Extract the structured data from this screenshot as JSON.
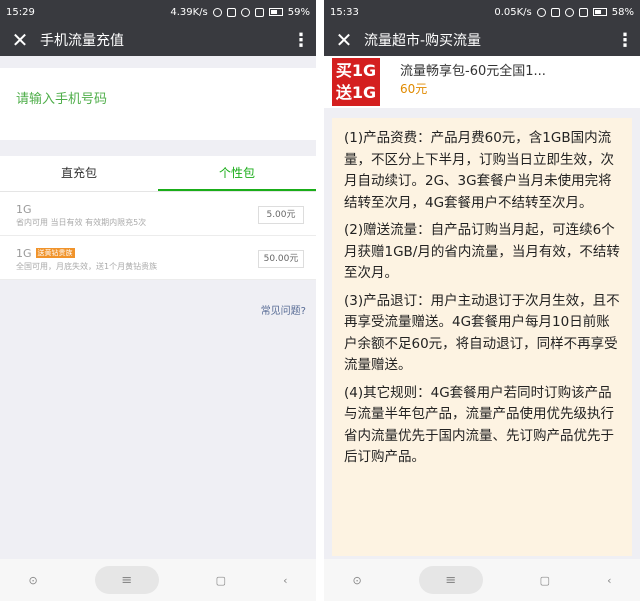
{
  "left": {
    "status": {
      "time": "15:29",
      "speed": "4.39K/s",
      "battery": "59%"
    },
    "title": "手机流量充值",
    "phone_placeholder": "请输入手机号码",
    "tabs": [
      "直充包",
      "个性包"
    ],
    "packages": [
      {
        "size": "1G",
        "badge": "",
        "desc": "省内可用 当日有效 有效期内限充5次",
        "price": "5.00元"
      },
      {
        "size": "1G",
        "badge": "送黄钻贵族",
        "desc": "全国可用，月底失效，送1个月黄钻贵族",
        "price": "50.00元"
      }
    ],
    "faq": "常见问题?"
  },
  "right": {
    "status": {
      "time": "15:33",
      "speed": "0.05K/s",
      "battery": "58%"
    },
    "title": "流量超市-购买流量",
    "product_image_text": [
      "买1G",
      "送1G"
    ],
    "product_name": "流量畅享包-60元全国1...",
    "product_price": "60元",
    "rules": [
      "(1)产品资费：产品月费60元，含1GB国内流量，不区分上下半月，订购当日立即生效，次月自动续订。2G、3G套餐户当月未使用完将结转至次月，4G套餐用户不结转至次月。",
      "(2)赠送流量：自产品订购当月起，可连续6个月获赠1GB/月的省内流量，当月有效，不结转至次月。",
      "(3)产品退订：用户主动退订于次月生效，且不再享受流量赠送。4G套餐用户每月10日前账户余额不足60元，将自动退订，同样不再享受流量赠送。",
      "(4)其它规则：4G套餐用户若同时订购该产品与流量半年包产品，流量产品使用优先级执行省内流量优先于国内流量、先订购产品优先于后订购产品。"
    ]
  },
  "nav": {
    "circle": "⊙",
    "home": "≡",
    "square": "▢",
    "back": "‹"
  },
  "colors": {
    "accent": "#1aad19",
    "titlebar": "#393a3f",
    "link": "#576b95",
    "price": "#e08a00"
  }
}
